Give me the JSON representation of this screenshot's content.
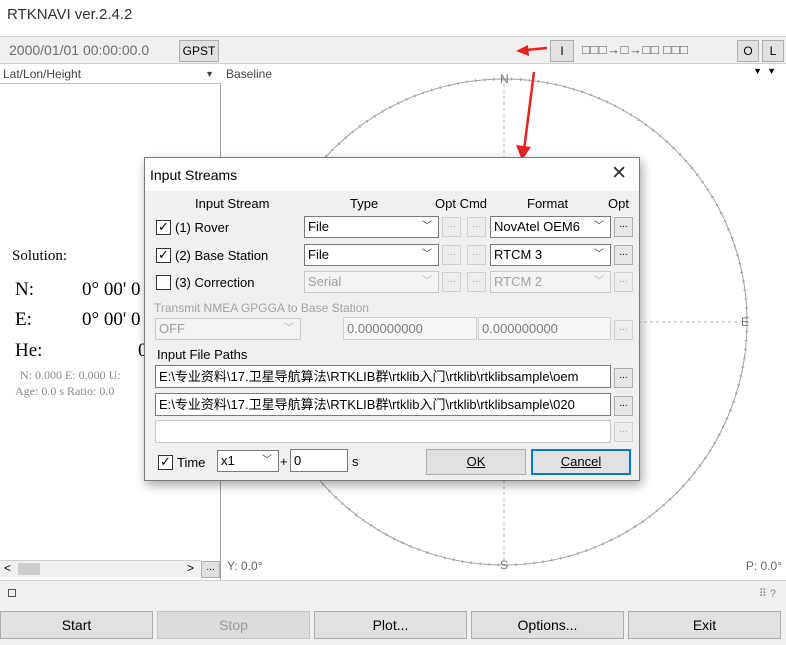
{
  "window": {
    "title": "RTKNAVI ver.2.4.2"
  },
  "toolbar": {
    "datetime": "2000/01/01 00:00:00.0",
    "time_system": "GPST",
    "input_button": "I",
    "stream_indicator": "□□□→□→□□ □□□",
    "output_button": "O",
    "log_button": "L"
  },
  "left_panel": {
    "selector": "Lat/Lon/Height",
    "solution_label": "Solution:",
    "n_label": "N:",
    "n_value": "0° 00' 0",
    "e_label": "E:",
    "e_value": "0° 00' 0",
    "he_label": "He:",
    "he_value": "0",
    "stats_line1": "N: 0.000 E: 0.000 U:",
    "stats_line2": "Age: 0.0 s Ratio: 0.0"
  },
  "right_panel": {
    "selector": "Baseline",
    "compass_n": "N",
    "compass_e": "E",
    "compass_s": "S",
    "y_readout": "Y: 0.0°",
    "p_readout": "P: 0.0°"
  },
  "bottom_buttons": {
    "start": "Start",
    "stop": "Stop",
    "plot": "Plot...",
    "options": "Options...",
    "exit": "Exit"
  },
  "dialog": {
    "title": "Input Streams",
    "headers": {
      "input_stream": "Input Stream",
      "type": "Type",
      "opt_cmd": "Opt Cmd",
      "format": "Format",
      "opt": "Opt"
    },
    "streams": [
      {
        "label": "(1) Rover",
        "checked": "✓",
        "type": "File",
        "format": "NovAtel OEM6"
      },
      {
        "label": "(2) Base Station",
        "checked": "✓",
        "type": "File",
        "format": "RTCM 3"
      },
      {
        "label": "(3) Correction",
        "checked": "",
        "type": "Serial",
        "format": "RTCM 2"
      }
    ],
    "nmea_label": "Transmit NMEA GPGGA to Base Station",
    "nmea_mode": "OFF",
    "nmea_lat": "0.000000000",
    "nmea_lon": "0.000000000",
    "file_paths_label": "Input File Paths",
    "file_path_1": "E:\\专业资料\\17.卫星导航算法\\RTKLIB群\\rtklib入门\\rtklib\\rtklibsample\\oem",
    "file_path_2": "E:\\专业资料\\17.卫星导航算法\\RTKLIB群\\rtklib入门\\rtklib\\rtklibsample\\020",
    "file_path_3": "",
    "time_label": "Time",
    "time_checked": "✓",
    "speed": "x1",
    "plus": "+",
    "offset": "0",
    "offset_unit": "s",
    "ok": "OK",
    "cancel": "Cancel",
    "ellipsis": "..."
  },
  "colors": {
    "annotation_arrow": "#e52421",
    "default_button_border": "#0078d7"
  }
}
